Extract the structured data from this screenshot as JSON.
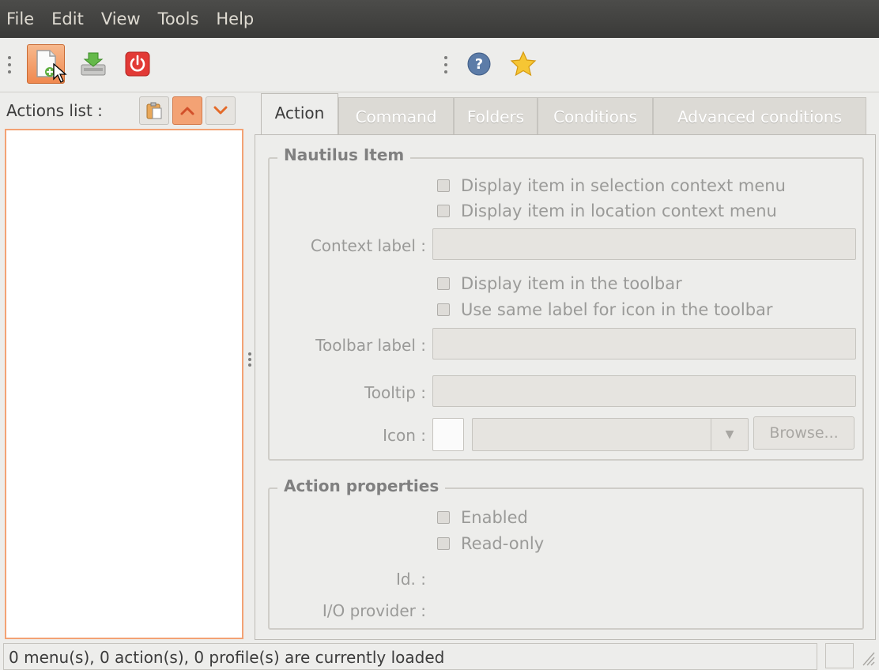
{
  "menubar": {
    "items": [
      {
        "label": "File"
      },
      {
        "label": "Edit"
      },
      {
        "label": "View"
      },
      {
        "label": "Tools"
      },
      {
        "label": "Help"
      }
    ]
  },
  "toolbar": {
    "buttons": [
      {
        "icon": "new-document-icon"
      },
      {
        "icon": "save-download-icon"
      },
      {
        "icon": "power-quit-icon"
      },
      {
        "icon": "help-icon"
      },
      {
        "icon": "star-icon"
      }
    ]
  },
  "actions_panel": {
    "label": "Actions list :",
    "buttons": [
      {
        "icon": "paste-icon"
      },
      {
        "icon": "chevron-up-icon"
      },
      {
        "icon": "chevron-down-icon"
      }
    ]
  },
  "tabs": [
    {
      "label": "Action"
    },
    {
      "label": "Command"
    },
    {
      "label": "Folders"
    },
    {
      "label": "Conditions"
    },
    {
      "label": "Advanced conditions"
    }
  ],
  "nautilus_item": {
    "title": "Nautilus Item",
    "cb_selection": "Display item in selection context menu",
    "cb_location": "Display item in location context menu",
    "context_label": "Context label :",
    "context_value": "",
    "cb_toolbar": "Display item in the toolbar",
    "cb_same_label": "Use same label for icon in the toolbar",
    "toolbar_label": "Toolbar label :",
    "toolbar_value": "",
    "tooltip_label": "Tooltip :",
    "tooltip_value": "",
    "icon_label": "Icon :",
    "icon_value": "",
    "browse": "Browse..."
  },
  "action_properties": {
    "title": "Action properties",
    "cb_enabled": "Enabled",
    "cb_readonly": "Read-only",
    "id_label": "Id. :",
    "io_label": "I/O provider :"
  },
  "status": {
    "text": "0 menu(s), 0 action(s), 0 profile(s) are currently loaded"
  },
  "colors": {
    "menubar_bg": "#3f3f3d",
    "accent": "#f0894f",
    "window_bg": "#ededeb"
  }
}
